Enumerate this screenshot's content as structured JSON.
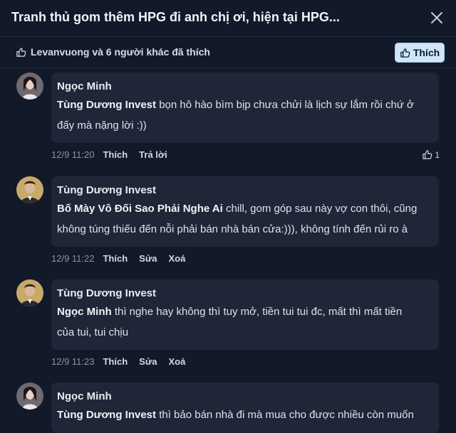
{
  "header": {
    "title": "Tranh thủ gom thêm HPG đi anh chị ơi, hiện tại HPG..."
  },
  "likes": {
    "summary": "Levanvuong và 6 người khác đã thích",
    "like_button": "Thích"
  },
  "comments": [
    {
      "author": "Ngọc Minh",
      "mention": "Tùng Dương Invest",
      "text_line1": " bọn hô hào bìm bịp chưa chửi là lịch sự lắm rồi chứ ở",
      "text_line2": "đấy mà nặng lời :))",
      "time": "12/9 11:20",
      "actions": [
        "Thích",
        "Trả lời"
      ],
      "like_count": "1"
    },
    {
      "author": "Tùng Dương Invest",
      "mention": "Bố Mày Vô Đối Sao Phải Nghe Ai",
      "text_line1": " chill, gom góp sau này vợ con thôi, cũng",
      "text_line2": "không túng thiếu đến nỗi phải bán nhà bán cửa:))), không tính đến rủi ro à",
      "time": "12/9 11:22",
      "actions": [
        "Thích",
        "Sửa",
        "Xoá"
      ]
    },
    {
      "author": "Tùng Dương Invest",
      "mention": "Ngọc Minh",
      "text_line1": " thì nghe hay không thì tuy mở, tiền tui tui đc, mất thì mất tiền",
      "text_line2": "của tui, tui chịu",
      "time": "12/9 11:23",
      "actions": [
        "Thích",
        "Sửa",
        "Xoá"
      ]
    },
    {
      "author": "Ngọc Minh",
      "mention": "Tùng Dương Invest",
      "text_line1": " thì bảo bán nhà đi mà mua cho được nhiều còn muốn",
      "text_line2": ""
    }
  ],
  "colors": {
    "background": "#121929",
    "bubble": "#1e2637",
    "like_button_bg": "#cfe6f8"
  }
}
